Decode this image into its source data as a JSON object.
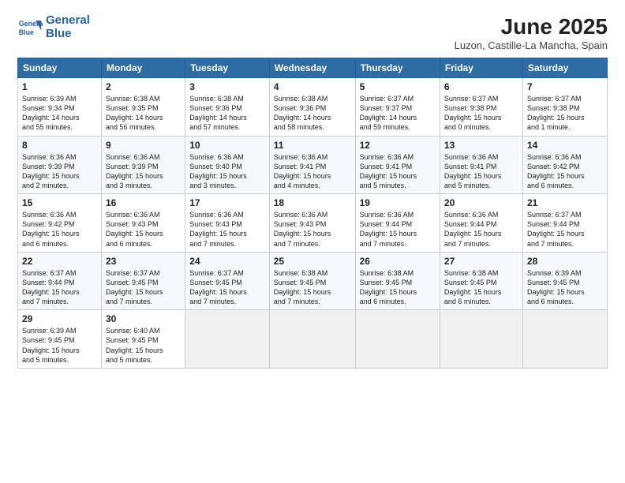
{
  "header": {
    "logo_line1": "General",
    "logo_line2": "Blue",
    "title": "June 2025",
    "subtitle": "Luzon, Castille-La Mancha, Spain"
  },
  "days_of_week": [
    "Sunday",
    "Monday",
    "Tuesday",
    "Wednesday",
    "Thursday",
    "Friday",
    "Saturday"
  ],
  "weeks": [
    [
      {
        "day": "1",
        "info": "Sunrise: 6:39 AM\nSunset: 9:34 PM\nDaylight: 14 hours\nand 55 minutes."
      },
      {
        "day": "2",
        "info": "Sunrise: 6:38 AM\nSunset: 9:35 PM\nDaylight: 14 hours\nand 56 minutes."
      },
      {
        "day": "3",
        "info": "Sunrise: 6:38 AM\nSunset: 9:36 PM\nDaylight: 14 hours\nand 57 minutes."
      },
      {
        "day": "4",
        "info": "Sunrise: 6:38 AM\nSunset: 9:36 PM\nDaylight: 14 hours\nand 58 minutes."
      },
      {
        "day": "5",
        "info": "Sunrise: 6:37 AM\nSunset: 9:37 PM\nDaylight: 14 hours\nand 59 minutes."
      },
      {
        "day": "6",
        "info": "Sunrise: 6:37 AM\nSunset: 9:38 PM\nDaylight: 15 hours\nand 0 minutes."
      },
      {
        "day": "7",
        "info": "Sunrise: 6:37 AM\nSunset: 9:38 PM\nDaylight: 15 hours\nand 1 minute."
      }
    ],
    [
      {
        "day": "8",
        "info": "Sunrise: 6:36 AM\nSunset: 9:39 PM\nDaylight: 15 hours\nand 2 minutes."
      },
      {
        "day": "9",
        "info": "Sunrise: 6:36 AM\nSunset: 9:39 PM\nDaylight: 15 hours\nand 3 minutes."
      },
      {
        "day": "10",
        "info": "Sunrise: 6:36 AM\nSunset: 9:40 PM\nDaylight: 15 hours\nand 3 minutes."
      },
      {
        "day": "11",
        "info": "Sunrise: 6:36 AM\nSunset: 9:41 PM\nDaylight: 15 hours\nand 4 minutes."
      },
      {
        "day": "12",
        "info": "Sunrise: 6:36 AM\nSunset: 9:41 PM\nDaylight: 15 hours\nand 5 minutes."
      },
      {
        "day": "13",
        "info": "Sunrise: 6:36 AM\nSunset: 9:41 PM\nDaylight: 15 hours\nand 5 minutes."
      },
      {
        "day": "14",
        "info": "Sunrise: 6:36 AM\nSunset: 9:42 PM\nDaylight: 15 hours\nand 6 minutes."
      }
    ],
    [
      {
        "day": "15",
        "info": "Sunrise: 6:36 AM\nSunset: 9:42 PM\nDaylight: 15 hours\nand 6 minutes."
      },
      {
        "day": "16",
        "info": "Sunrise: 6:36 AM\nSunset: 9:43 PM\nDaylight: 15 hours\nand 6 minutes."
      },
      {
        "day": "17",
        "info": "Sunrise: 6:36 AM\nSunset: 9:43 PM\nDaylight: 15 hours\nand 7 minutes."
      },
      {
        "day": "18",
        "info": "Sunrise: 6:36 AM\nSunset: 9:43 PM\nDaylight: 15 hours\nand 7 minutes."
      },
      {
        "day": "19",
        "info": "Sunrise: 6:36 AM\nSunset: 9:44 PM\nDaylight: 15 hours\nand 7 minutes."
      },
      {
        "day": "20",
        "info": "Sunrise: 6:36 AM\nSunset: 9:44 PM\nDaylight: 15 hours\nand 7 minutes."
      },
      {
        "day": "21",
        "info": "Sunrise: 6:37 AM\nSunset: 9:44 PM\nDaylight: 15 hours\nand 7 minutes."
      }
    ],
    [
      {
        "day": "22",
        "info": "Sunrise: 6:37 AM\nSunset: 9:44 PM\nDaylight: 15 hours\nand 7 minutes."
      },
      {
        "day": "23",
        "info": "Sunrise: 6:37 AM\nSunset: 9:45 PM\nDaylight: 15 hours\nand 7 minutes."
      },
      {
        "day": "24",
        "info": "Sunrise: 6:37 AM\nSunset: 9:45 PM\nDaylight: 15 hours\nand 7 minutes."
      },
      {
        "day": "25",
        "info": "Sunrise: 6:38 AM\nSunset: 9:45 PM\nDaylight: 15 hours\nand 7 minutes."
      },
      {
        "day": "26",
        "info": "Sunrise: 6:38 AM\nSunset: 9:45 PM\nDaylight: 15 hours\nand 6 minutes."
      },
      {
        "day": "27",
        "info": "Sunrise: 6:38 AM\nSunset: 9:45 PM\nDaylight: 15 hours\nand 6 minutes."
      },
      {
        "day": "28",
        "info": "Sunrise: 6:39 AM\nSunset: 9:45 PM\nDaylight: 15 hours\nand 6 minutes."
      }
    ],
    [
      {
        "day": "29",
        "info": "Sunrise: 6:39 AM\nSunset: 9:45 PM\nDaylight: 15 hours\nand 5 minutes."
      },
      {
        "day": "30",
        "info": "Sunrise: 6:40 AM\nSunset: 9:45 PM\nDaylight: 15 hours\nand 5 minutes."
      },
      {
        "day": "",
        "info": ""
      },
      {
        "day": "",
        "info": ""
      },
      {
        "day": "",
        "info": ""
      },
      {
        "day": "",
        "info": ""
      },
      {
        "day": "",
        "info": ""
      }
    ]
  ]
}
